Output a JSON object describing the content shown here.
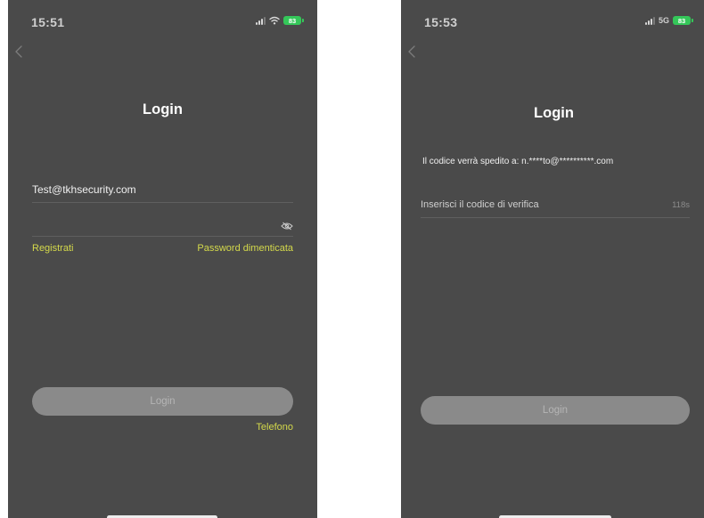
{
  "screen_left": {
    "status": {
      "time": "15:51",
      "battery": "83"
    },
    "title": "Login",
    "email_value": "Test@tkhsecurity.com",
    "password_value": "",
    "register_label": "Registrati",
    "forgot_label": "Password dimenticata",
    "login_label": "Login",
    "phone_label": "Telefono"
  },
  "screen_right": {
    "status": {
      "time": "15:53",
      "network": "5G",
      "battery": "83"
    },
    "title": "Login",
    "info_text": "Il codice verrà spedito a: n.****to@**********.com",
    "code_placeholder": "Inserisci il codice di verifica",
    "countdown": "118s",
    "login_label": "Login"
  },
  "colors": {
    "background": "#4a4a4a",
    "accent": "#d4d94b",
    "button": "#8a8a8a",
    "battery": "#34c759"
  },
  "icons": [
    "back-chevron-icon",
    "signal-icon",
    "wifi-icon",
    "battery-icon",
    "eye-slash-icon"
  ]
}
